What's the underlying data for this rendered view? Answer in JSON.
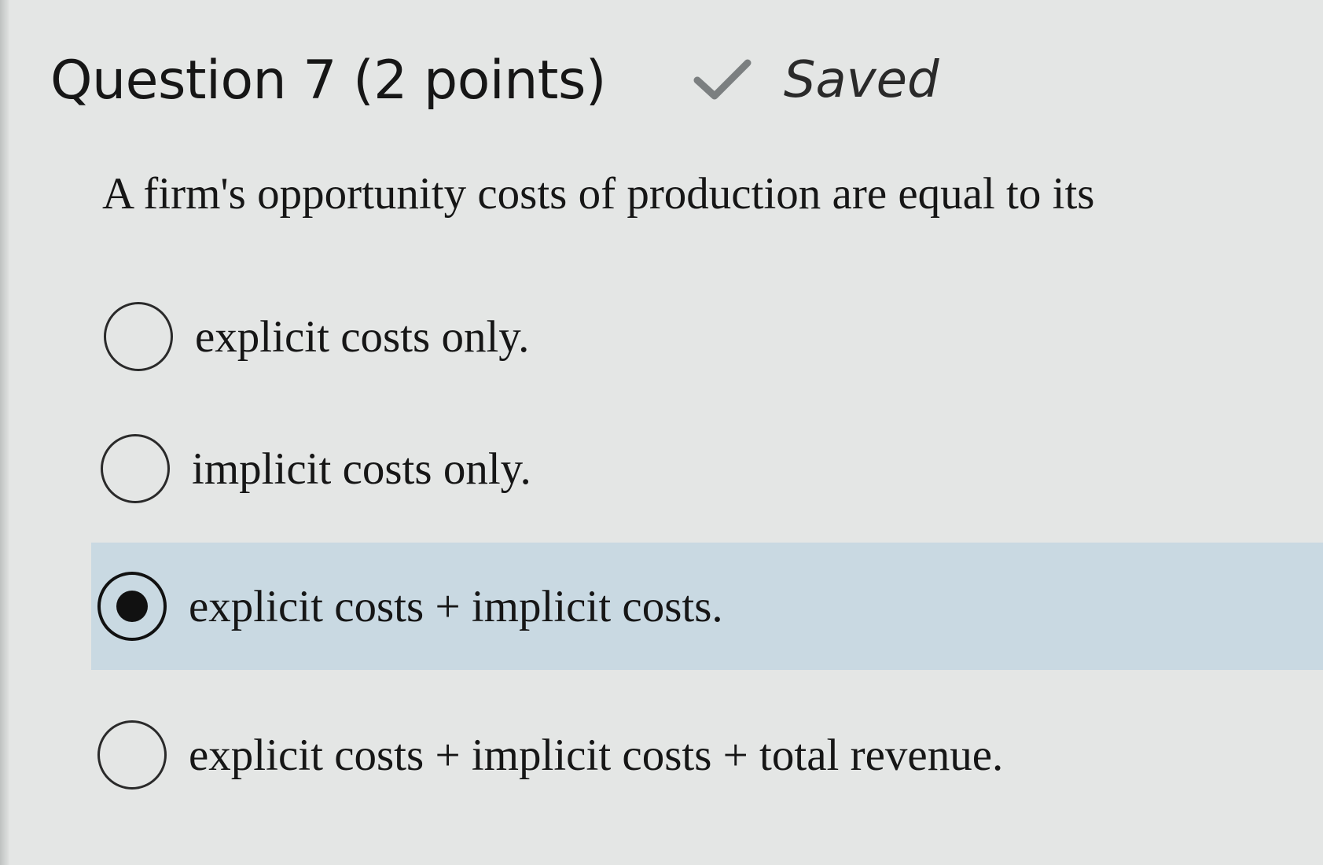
{
  "question": {
    "title": "Question 7 (2 points)",
    "status_icon": "check-icon",
    "status_label": "Saved",
    "prompt": "A firm's opportunity costs of production are equal to its"
  },
  "options": [
    {
      "label": "explicit costs only.",
      "selected": false
    },
    {
      "label": "implicit costs only.",
      "selected": false
    },
    {
      "label": "explicit costs + implicit costs.",
      "selected": true
    },
    {
      "label": "explicit costs + implicit costs + total revenue.",
      "selected": false
    }
  ],
  "colors": {
    "background": "#e4e6e5",
    "selected_row": "#c9d9e2",
    "text": "#161616",
    "check_icon": "#7b7f80"
  }
}
